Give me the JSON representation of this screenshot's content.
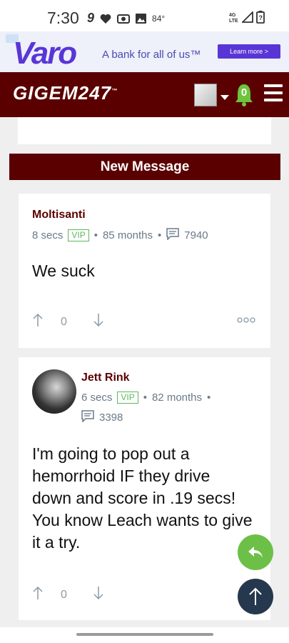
{
  "status_bar": {
    "time": "7:30",
    "temperature": "84°",
    "network": "4G LTE"
  },
  "ad": {
    "brand": "Varo",
    "tagline": "A bank for all of us™",
    "cta": "Learn more >"
  },
  "nav": {
    "logo_text": "GIGEM",
    "logo_num": "247",
    "notification_count": "0"
  },
  "new_message_label": "New Message",
  "posts": [
    {
      "username": "Moltisanti",
      "time": "8 secs",
      "badge": "VIP",
      "tenure": "85 months",
      "post_count": "7940",
      "body": "We suck",
      "votes": "0"
    },
    {
      "username": "Jett Rink",
      "time": "6 secs",
      "badge": "VIP",
      "tenure": "82 months",
      "post_count": "3398",
      "body": "I'm going to pop out a hemorrhoid IF they drive down and score in .19 secs! You know Leach wants to give it a try.",
      "votes": "0"
    }
  ],
  "colors": {
    "brand_maroon": "#5a0000",
    "vip_green": "#5cb85c",
    "reply_fab": "#6dc047",
    "top_fab": "#25384d"
  },
  "icons": [
    "heart-icon",
    "camera-icon",
    "image-icon",
    "wifi-icon",
    "signal-icon",
    "battery-icon",
    "bell-icon",
    "menu-icon",
    "comment-icon",
    "upvote-icon",
    "downvote-icon",
    "more-icon",
    "reply-icon",
    "scroll-top-icon"
  ]
}
